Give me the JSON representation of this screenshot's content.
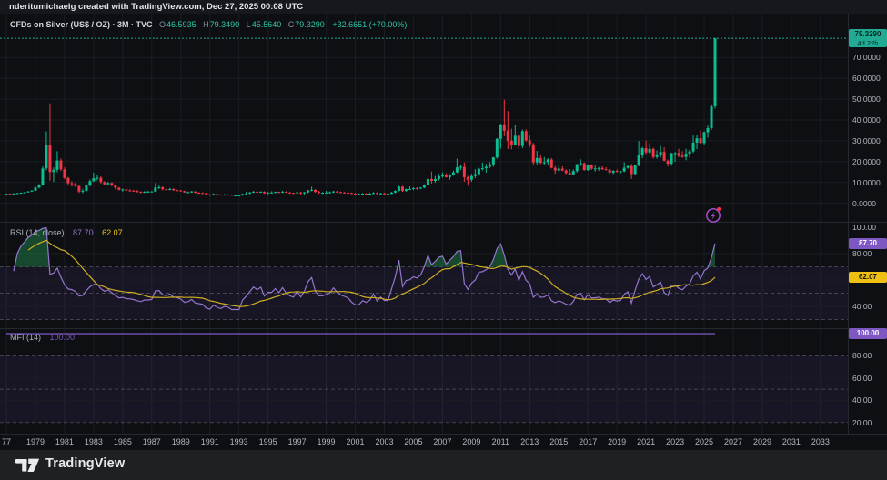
{
  "header": {
    "attribution": "nderitumichaelg created with TradingView.com, Dec 27, 2025 00:08 UTC"
  },
  "footer": {
    "brand": "TradingView"
  },
  "legend": {
    "title": "CFDs on Silver (US$ / OZ) · 3M · TVC",
    "o_label": "O",
    "o": "46.5935",
    "h_label": "H",
    "h": "79.3490",
    "l_label": "L",
    "l": "45.5640",
    "c_label": "C",
    "c": "79.3290",
    "change": "+32.6651 (+70.00%)"
  },
  "price_badge": {
    "price": "79.3290",
    "countdown": "4d 22h"
  },
  "rsi": {
    "title": "RSI (14, close)",
    "value": "87.70",
    "ma_value": "62.07"
  },
  "mfi": {
    "title": "MFI (14)",
    "value": "100.00"
  },
  "colors": {
    "up": "#0cbd92",
    "down": "#f23645",
    "price_line": "#22ab94",
    "price_badge_bg": "#22ab94",
    "price_badge_text": "#07261f",
    "rsi_line": "#9575cd",
    "rsi_badge_bg": "#7e57c2",
    "ma_line": "#cfae22",
    "ma_badge_bg": "#efc012",
    "mfi_line": "#7e57c2",
    "overbought_fill": "#1f7a44",
    "grid": "#1a1d22",
    "separator": "#24282f",
    "band_tint": "rgba(126,87,194,0.10)",
    "dashed_level": "rgba(173,178,190,0.30)",
    "scale_text": "#b2b6bf"
  },
  "time_axis_labels": [
    "77",
    "1979",
    "1981",
    "1983",
    "1985",
    "1987",
    "1989",
    "1991",
    "1993",
    "1995",
    "1997",
    "1999",
    "2001",
    "2003",
    "2005",
    "2007",
    "2009",
    "2011",
    "2013",
    "2015",
    "2017",
    "2019",
    "2021",
    "2023",
    "2025",
    "2027",
    "2029",
    "2031",
    "2033"
  ],
  "chart_data": {
    "type": "candlestick",
    "symbol": "CFDs on Silver (US$ / OZ)",
    "timeframe": "3M",
    "exchange": "TVC",
    "x_start_year": 1977,
    "x_end_year": 2033,
    "candles_per_year": 4,
    "price_axis": {
      "min": 0,
      "max": 91,
      "ticks": [
        70,
        60,
        50,
        40,
        30,
        20,
        10,
        0
      ]
    },
    "last_candle": {
      "open": 46.5935,
      "high": 79.349,
      "low": 45.564,
      "close": 79.329,
      "change": 32.6651,
      "change_pct": 70.0,
      "countdown": "4d 22h"
    },
    "indicators": [
      {
        "name": "RSI",
        "params": "14, close",
        "value": 87.7,
        "ma_value": 62.07,
        "dashed_levels": [
          70,
          50,
          30
        ],
        "scale_ticks": [
          100,
          80,
          40
        ],
        "band": [
          30,
          70
        ]
      },
      {
        "name": "MFI",
        "params": "14",
        "value": 100.0,
        "dashed_levels": [
          80,
          50,
          20
        ],
        "scale_ticks": [
          80,
          60,
          40,
          20
        ],
        "band": [
          20,
          80
        ]
      }
    ],
    "ohlc": [
      [
        4.4,
        4.6,
        4.2,
        4.5
      ],
      [
        4.5,
        4.7,
        4.3,
        4.4
      ],
      [
        4.4,
        4.8,
        4.3,
        4.6
      ],
      [
        4.6,
        5.0,
        4.5,
        4.8
      ],
      [
        4.8,
        5.1,
        4.6,
        5.0
      ],
      [
        5.0,
        5.4,
        4.8,
        5.2
      ],
      [
        5.2,
        5.8,
        5.1,
        5.6
      ],
      [
        5.6,
        6.3,
        5.4,
        6.0
      ],
      [
        6.0,
        7.9,
        5.9,
        7.5
      ],
      [
        7.5,
        9.2,
        7.2,
        8.6
      ],
      [
        8.6,
        17.8,
        8.4,
        16.7
      ],
      [
        16.7,
        34.5,
        15.8,
        28.0
      ],
      [
        28.0,
        48.0,
        10.8,
        15.0
      ],
      [
        15.0,
        17.2,
        10.2,
        16.0
      ],
      [
        16.0,
        25.0,
        14.8,
        20.5
      ],
      [
        20.5,
        21.5,
        15.4,
        16.3
      ],
      [
        16.3,
        17.2,
        11.6,
        12.1
      ],
      [
        12.1,
        12.6,
        8.4,
        9.6
      ],
      [
        9.6,
        10.6,
        8.0,
        9.2
      ],
      [
        9.2,
        9.9,
        7.9,
        8.2
      ],
      [
        8.2,
        8.6,
        4.9,
        5.6
      ],
      [
        5.6,
        6.9,
        4.8,
        5.9
      ],
      [
        5.9,
        9.2,
        5.6,
        8.5
      ],
      [
        8.5,
        11.4,
        8.0,
        10.6
      ],
      [
        10.6,
        14.7,
        10.2,
        12.0
      ],
      [
        12.0,
        13.6,
        10.9,
        12.2
      ],
      [
        12.2,
        12.9,
        9.4,
        10.2
      ],
      [
        10.2,
        10.6,
        8.7,
        9.1
      ],
      [
        9.1,
        10.2,
        8.6,
        9.7
      ],
      [
        9.7,
        10.1,
        8.1,
        8.6
      ],
      [
        8.6,
        9.0,
        6.6,
        7.4
      ],
      [
        7.4,
        7.8,
        6.1,
        6.4
      ],
      [
        6.4,
        7.0,
        5.5,
        6.6
      ],
      [
        6.6,
        6.9,
        5.7,
        6.1
      ],
      [
        6.1,
        6.7,
        5.6,
        6.0
      ],
      [
        6.0,
        6.4,
        5.4,
        5.8
      ],
      [
        5.8,
        6.3,
        5.1,
        5.4
      ],
      [
        5.4,
        5.7,
        4.8,
        5.1
      ],
      [
        5.1,
        5.8,
        4.9,
        5.5
      ],
      [
        5.5,
        6.0,
        5.1,
        5.5
      ],
      [
        5.5,
        5.8,
        5.2,
        5.6
      ],
      [
        5.6,
        9.7,
        5.4,
        7.5
      ],
      [
        7.5,
        8.8,
        6.9,
        7.6
      ],
      [
        7.6,
        8.1,
        6.1,
        6.7
      ],
      [
        6.7,
        7.0,
        6.1,
        6.5
      ],
      [
        6.5,
        7.3,
        6.2,
        6.8
      ],
      [
        6.8,
        7.1,
        5.9,
        6.2
      ],
      [
        6.2,
        6.5,
        5.8,
        6.1
      ],
      [
        6.1,
        6.3,
        5.5,
        5.8
      ],
      [
        5.8,
        6.0,
        5.0,
        5.2
      ],
      [
        5.2,
        5.6,
        4.9,
        5.3
      ],
      [
        5.3,
        5.9,
        5.0,
        5.6
      ],
      [
        5.6,
        5.7,
        4.8,
        5.0
      ],
      [
        5.0,
        5.3,
        4.6,
        4.9
      ],
      [
        4.9,
        5.2,
        4.5,
        4.8
      ],
      [
        4.8,
        5.0,
        3.8,
        4.2
      ],
      [
        4.2,
        4.4,
        3.5,
        4.0
      ],
      [
        4.0,
        4.7,
        3.8,
        4.4
      ],
      [
        4.4,
        4.6,
        3.8,
        4.1
      ],
      [
        4.1,
        4.3,
        3.7,
        3.9
      ],
      [
        3.9,
        4.4,
        3.8,
        4.1
      ],
      [
        4.1,
        4.3,
        3.8,
        4.0
      ],
      [
        4.0,
        4.2,
        3.6,
        3.7
      ],
      [
        3.7,
        3.9,
        3.5,
        3.7
      ],
      [
        3.7,
        4.0,
        3.5,
        3.7
      ],
      [
        3.7,
        4.6,
        3.6,
        4.4
      ],
      [
        4.4,
        5.4,
        4.1,
        4.7
      ],
      [
        4.7,
        5.4,
        4.3,
        5.1
      ],
      [
        5.1,
        5.9,
        4.9,
        5.5
      ],
      [
        5.5,
        5.9,
        5.1,
        5.3
      ],
      [
        5.3,
        5.7,
        5.0,
        5.5
      ],
      [
        5.5,
        5.7,
        4.5,
        4.8
      ],
      [
        4.8,
        5.3,
        4.3,
        5.1
      ],
      [
        5.1,
        5.7,
        4.9,
        5.1
      ],
      [
        5.1,
        5.6,
        4.8,
        5.4
      ],
      [
        5.4,
        5.6,
        4.8,
        5.1
      ],
      [
        5.1,
        5.9,
        4.9,
        5.5
      ],
      [
        5.5,
        5.7,
        4.9,
        5.1
      ],
      [
        5.1,
        5.4,
        4.7,
        4.9
      ],
      [
        4.9,
        5.1,
        4.5,
        4.8
      ],
      [
        4.8,
        5.4,
        4.5,
        5.2
      ],
      [
        5.2,
        5.4,
        4.1,
        4.8
      ],
      [
        4.8,
        5.4,
        4.2,
        5.2
      ],
      [
        5.2,
        6.4,
        4.8,
        6.0
      ],
      [
        6.0,
        7.9,
        5.7,
        6.4
      ],
      [
        6.4,
        6.7,
        5.0,
        5.4
      ],
      [
        5.4,
        5.9,
        4.5,
        5.0
      ],
      [
        5.0,
        5.3,
        4.5,
        5.0
      ],
      [
        5.0,
        5.9,
        4.8,
        5.1
      ],
      [
        5.1,
        5.6,
        4.8,
        5.2
      ],
      [
        5.2,
        5.9,
        4.9,
        5.6
      ],
      [
        5.6,
        5.9,
        4.9,
        5.3
      ],
      [
        5.3,
        5.6,
        4.9,
        5.1
      ],
      [
        5.1,
        5.4,
        4.8,
        5.0
      ],
      [
        5.0,
        5.2,
        4.6,
        4.9
      ],
      [
        4.9,
        5.1,
        4.4,
        4.6
      ],
      [
        4.6,
        4.9,
        4.2,
        4.4
      ],
      [
        4.4,
        4.7,
        4.1,
        4.4
      ],
      [
        4.4,
        4.8,
        4.0,
        4.6
      ],
      [
        4.6,
        4.8,
        3.9,
        4.5
      ],
      [
        4.5,
        4.9,
        4.2,
        4.6
      ],
      [
        4.6,
        5.3,
        4.4,
        4.9
      ],
      [
        4.9,
        5.2,
        4.3,
        4.5
      ],
      [
        4.5,
        5.0,
        4.3,
        4.7
      ],
      [
        4.7,
        5.0,
        4.3,
        4.5
      ],
      [
        4.5,
        5.0,
        4.2,
        4.5
      ],
      [
        4.5,
        5.4,
        4.4,
        5.1
      ],
      [
        5.1,
        6.1,
        4.8,
        5.9
      ],
      [
        5.9,
        8.4,
        5.7,
        7.9
      ],
      [
        7.9,
        8.3,
        5.4,
        5.9
      ],
      [
        5.9,
        7.0,
        5.5,
        6.7
      ],
      [
        6.7,
        8.1,
        6.4,
        6.8
      ],
      [
        6.8,
        7.7,
        6.3,
        7.2
      ],
      [
        7.2,
        7.7,
        6.5,
        7.1
      ],
      [
        7.1,
        7.6,
        6.7,
        7.5
      ],
      [
        7.5,
        9.1,
        7.2,
        8.8
      ],
      [
        8.8,
        12.1,
        8.6,
        11.6
      ],
      [
        11.6,
        15.2,
        9.4,
        10.7
      ],
      [
        10.7,
        13.1,
        9.8,
        11.6
      ],
      [
        11.6,
        14.1,
        10.8,
        12.9
      ],
      [
        12.9,
        14.8,
        12.2,
        13.3
      ],
      [
        13.3,
        14.3,
        12.3,
        12.5
      ],
      [
        12.5,
        13.9,
        11.3,
        13.6
      ],
      [
        13.6,
        15.6,
        13.2,
        14.8
      ],
      [
        14.8,
        21.4,
        14.5,
        17.2
      ],
      [
        17.2,
        18.6,
        15.9,
        17.5
      ],
      [
        17.5,
        19.6,
        10.3,
        12.5
      ],
      [
        12.5,
        13.1,
        8.4,
        11.3
      ],
      [
        11.3,
        14.1,
        10.3,
        13.0
      ],
      [
        13.0,
        16.3,
        12.0,
        13.9
      ],
      [
        13.9,
        17.7,
        13.1,
        16.6
      ],
      [
        16.6,
        19.5,
        15.7,
        16.8
      ],
      [
        16.8,
        18.9,
        14.6,
        17.5
      ],
      [
        17.5,
        19.9,
        16.9,
        18.7
      ],
      [
        18.7,
        22.2,
        17.5,
        22.0
      ],
      [
        22.0,
        31.3,
        21.3,
        30.9
      ],
      [
        30.9,
        38.2,
        26.2,
        37.9
      ],
      [
        37.9,
        49.8,
        32.2,
        34.8
      ],
      [
        34.8,
        44.3,
        26.0,
        30.0
      ],
      [
        30.0,
        35.8,
        25.9,
        27.9
      ],
      [
        27.9,
        37.5,
        27.7,
        32.4
      ],
      [
        32.4,
        33.4,
        26.0,
        27.5
      ],
      [
        27.5,
        35.4,
        26.5,
        34.6
      ],
      [
        34.6,
        35.5,
        29.5,
        30.2
      ],
      [
        30.2,
        32.5,
        26.9,
        28.3
      ],
      [
        28.3,
        29.0,
        18.2,
        19.6
      ],
      [
        19.6,
        25.1,
        18.5,
        21.7
      ],
      [
        21.7,
        23.4,
        18.8,
        19.4
      ],
      [
        19.4,
        22.2,
        18.6,
        19.7
      ],
      [
        19.7,
        21.6,
        18.5,
        21.0
      ],
      [
        21.0,
        21.6,
        16.7,
        17.0
      ],
      [
        17.0,
        17.9,
        14.1,
        15.7
      ],
      [
        15.7,
        18.5,
        15.2,
        16.6
      ],
      [
        16.6,
        17.8,
        15.3,
        15.7
      ],
      [
        15.7,
        16.3,
        13.9,
        14.5
      ],
      [
        14.5,
        16.4,
        13.6,
        13.8
      ],
      [
        13.8,
        16.2,
        13.6,
        15.4
      ],
      [
        15.4,
        18.9,
        14.7,
        18.7
      ],
      [
        18.7,
        21.1,
        17.9,
        19.2
      ],
      [
        19.2,
        19.6,
        15.6,
        15.9
      ],
      [
        15.9,
        18.6,
        15.5,
        18.2
      ],
      [
        18.2,
        18.7,
        16.0,
        16.6
      ],
      [
        16.6,
        18.2,
        15.2,
        16.7
      ],
      [
        16.7,
        17.4,
        15.5,
        16.9
      ],
      [
        16.9,
        17.7,
        16.0,
        16.3
      ],
      [
        16.3,
        17.3,
        15.8,
        16.1
      ],
      [
        16.1,
        16.3,
        13.9,
        14.7
      ],
      [
        14.7,
        15.9,
        13.9,
        15.5
      ],
      [
        15.5,
        16.2,
        14.7,
        15.1
      ],
      [
        15.1,
        15.6,
        14.3,
        15.3
      ],
      [
        15.3,
        19.7,
        14.9,
        17.0
      ],
      [
        17.0,
        18.4,
        16.5,
        17.8
      ],
      [
        17.8,
        18.9,
        11.6,
        14.0
      ],
      [
        14.0,
        18.5,
        13.8,
        18.2
      ],
      [
        18.2,
        29.9,
        17.7,
        23.2
      ],
      [
        23.2,
        27.0,
        21.6,
        26.4
      ],
      [
        26.4,
        30.1,
        23.6,
        24.4
      ],
      [
        24.4,
        28.9,
        23.7,
        26.1
      ],
      [
        26.1,
        26.7,
        21.4,
        22.2
      ],
      [
        22.2,
        25.4,
        21.4,
        23.3
      ],
      [
        23.3,
        27.5,
        21.9,
        24.6
      ],
      [
        24.6,
        26.9,
        20.2,
        20.4
      ],
      [
        20.4,
        21.0,
        17.6,
        19.0
      ],
      [
        19.0,
        24.3,
        18.0,
        24.0
      ],
      [
        24.0,
        24.6,
        19.9,
        24.1
      ],
      [
        24.1,
        26.1,
        22.1,
        22.8
      ],
      [
        22.8,
        25.0,
        21.8,
        22.2
      ],
      [
        22.2,
        26.1,
        20.6,
        23.8
      ],
      [
        23.8,
        25.8,
        21.9,
        24.9
      ],
      [
        24.9,
        32.5,
        24.2,
        29.1
      ],
      [
        29.1,
        32.9,
        26.0,
        31.2
      ],
      [
        31.2,
        35.1,
        28.7,
        28.9
      ],
      [
        28.9,
        34.6,
        28.2,
        34.1
      ],
      [
        34.1,
        37.3,
        31.5,
        36.1
      ],
      [
        36.1,
        47.6,
        35.2,
        46.6
      ],
      [
        46.5935,
        79.349,
        45.564,
        79.329
      ]
    ]
  }
}
